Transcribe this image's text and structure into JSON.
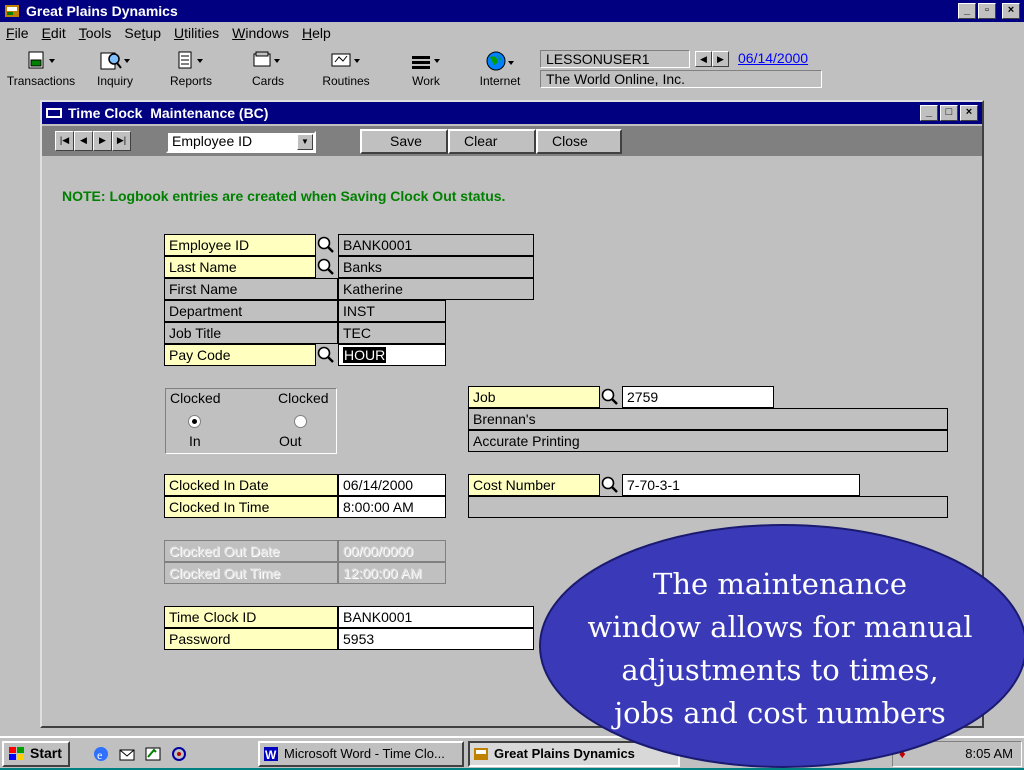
{
  "app": {
    "title": "Great Plains Dynamics",
    "window_buttons": {
      "minimize": "_",
      "restore": "▫",
      "close": "×"
    }
  },
  "menu": [
    {
      "key": "F",
      "rest": "ile"
    },
    {
      "key": "E",
      "rest": "dit"
    },
    {
      "key": "T",
      "rest": "ools"
    },
    {
      "pre": "Se",
      "key": "t",
      "rest": "up"
    },
    {
      "key": "U",
      "rest": "tilities"
    },
    {
      "key": "W",
      "rest": "indows"
    },
    {
      "key": "H",
      "rest": "elp"
    }
  ],
  "toolbar": {
    "transactions": "Transactions",
    "inquiry": "Inquiry",
    "reports": "Reports",
    "cards": "Cards",
    "routines": "Routines",
    "work": "Work",
    "internet": "Internet"
  },
  "user_box": {
    "user": "LESSONUSER1",
    "date": "06/14/2000",
    "company": "The World Online, Inc."
  },
  "child": {
    "title": "Time Clock  Maintenance (BC)",
    "lookup_select": "Employee ID",
    "save_label": "Save",
    "clear_label": "Clear",
    "close_label": "Close"
  },
  "note": "NOTE: Logbook entries are created when Saving Clock Out status.",
  "fields": {
    "employee_id_label": "Employee ID",
    "employee_id": "BANK0001",
    "last_name_label": "Last Name",
    "last_name": "Banks",
    "first_name_label": "First Name",
    "first_name": "Katherine",
    "department_label": "Department",
    "department": "INST",
    "job_title_label": "Job Title",
    "job_title": "TEC",
    "pay_code_label": "Pay Code",
    "pay_code": "HOUR",
    "clocked_label_in": "Clocked",
    "clocked_label_out": "Clocked",
    "in_label": "In",
    "out_label": "Out",
    "clocked_in_selected": true,
    "job_label": "Job",
    "job": "2759",
    "job_line1": "Brennan's",
    "job_line2": "Accurate Printing",
    "clocked_in_date_label": "Clocked In Date",
    "clocked_in_date": "06/14/2000",
    "clocked_in_time_label": "Clocked In Time",
    "clocked_in_time": "8:00:00 AM",
    "cost_number_label": "Cost Number",
    "cost_number": "7-70-3-1",
    "clocked_out_date_label": "Clocked Out Date",
    "clocked_out_date": "00/00/0000",
    "clocked_out_time_label": "Clocked Out Time",
    "clocked_out_time": "12:00:00 AM",
    "time_clock_id_label": "Time Clock ID",
    "time_clock_id": "BANK0001",
    "password_label": "Password",
    "password": "5953"
  },
  "callout": "The maintenance window allows for manual adjustments to times, jobs and cost numbers",
  "callout_lines": [
    "The maintenance",
    "window allows for manual",
    "adjustments to times,",
    "jobs and cost numbers"
  ],
  "taskbar": {
    "start": "Start",
    "task_word": "Microsoft Word - Time Clo...",
    "task_gp": "Great Plains Dynamics",
    "clock": "8:05 AM"
  },
  "colors": {
    "title_blue": "#000080",
    "note_green": "#008000",
    "label_yellow": "#ffffc0",
    "callout_fill": "#3a3ab8"
  }
}
